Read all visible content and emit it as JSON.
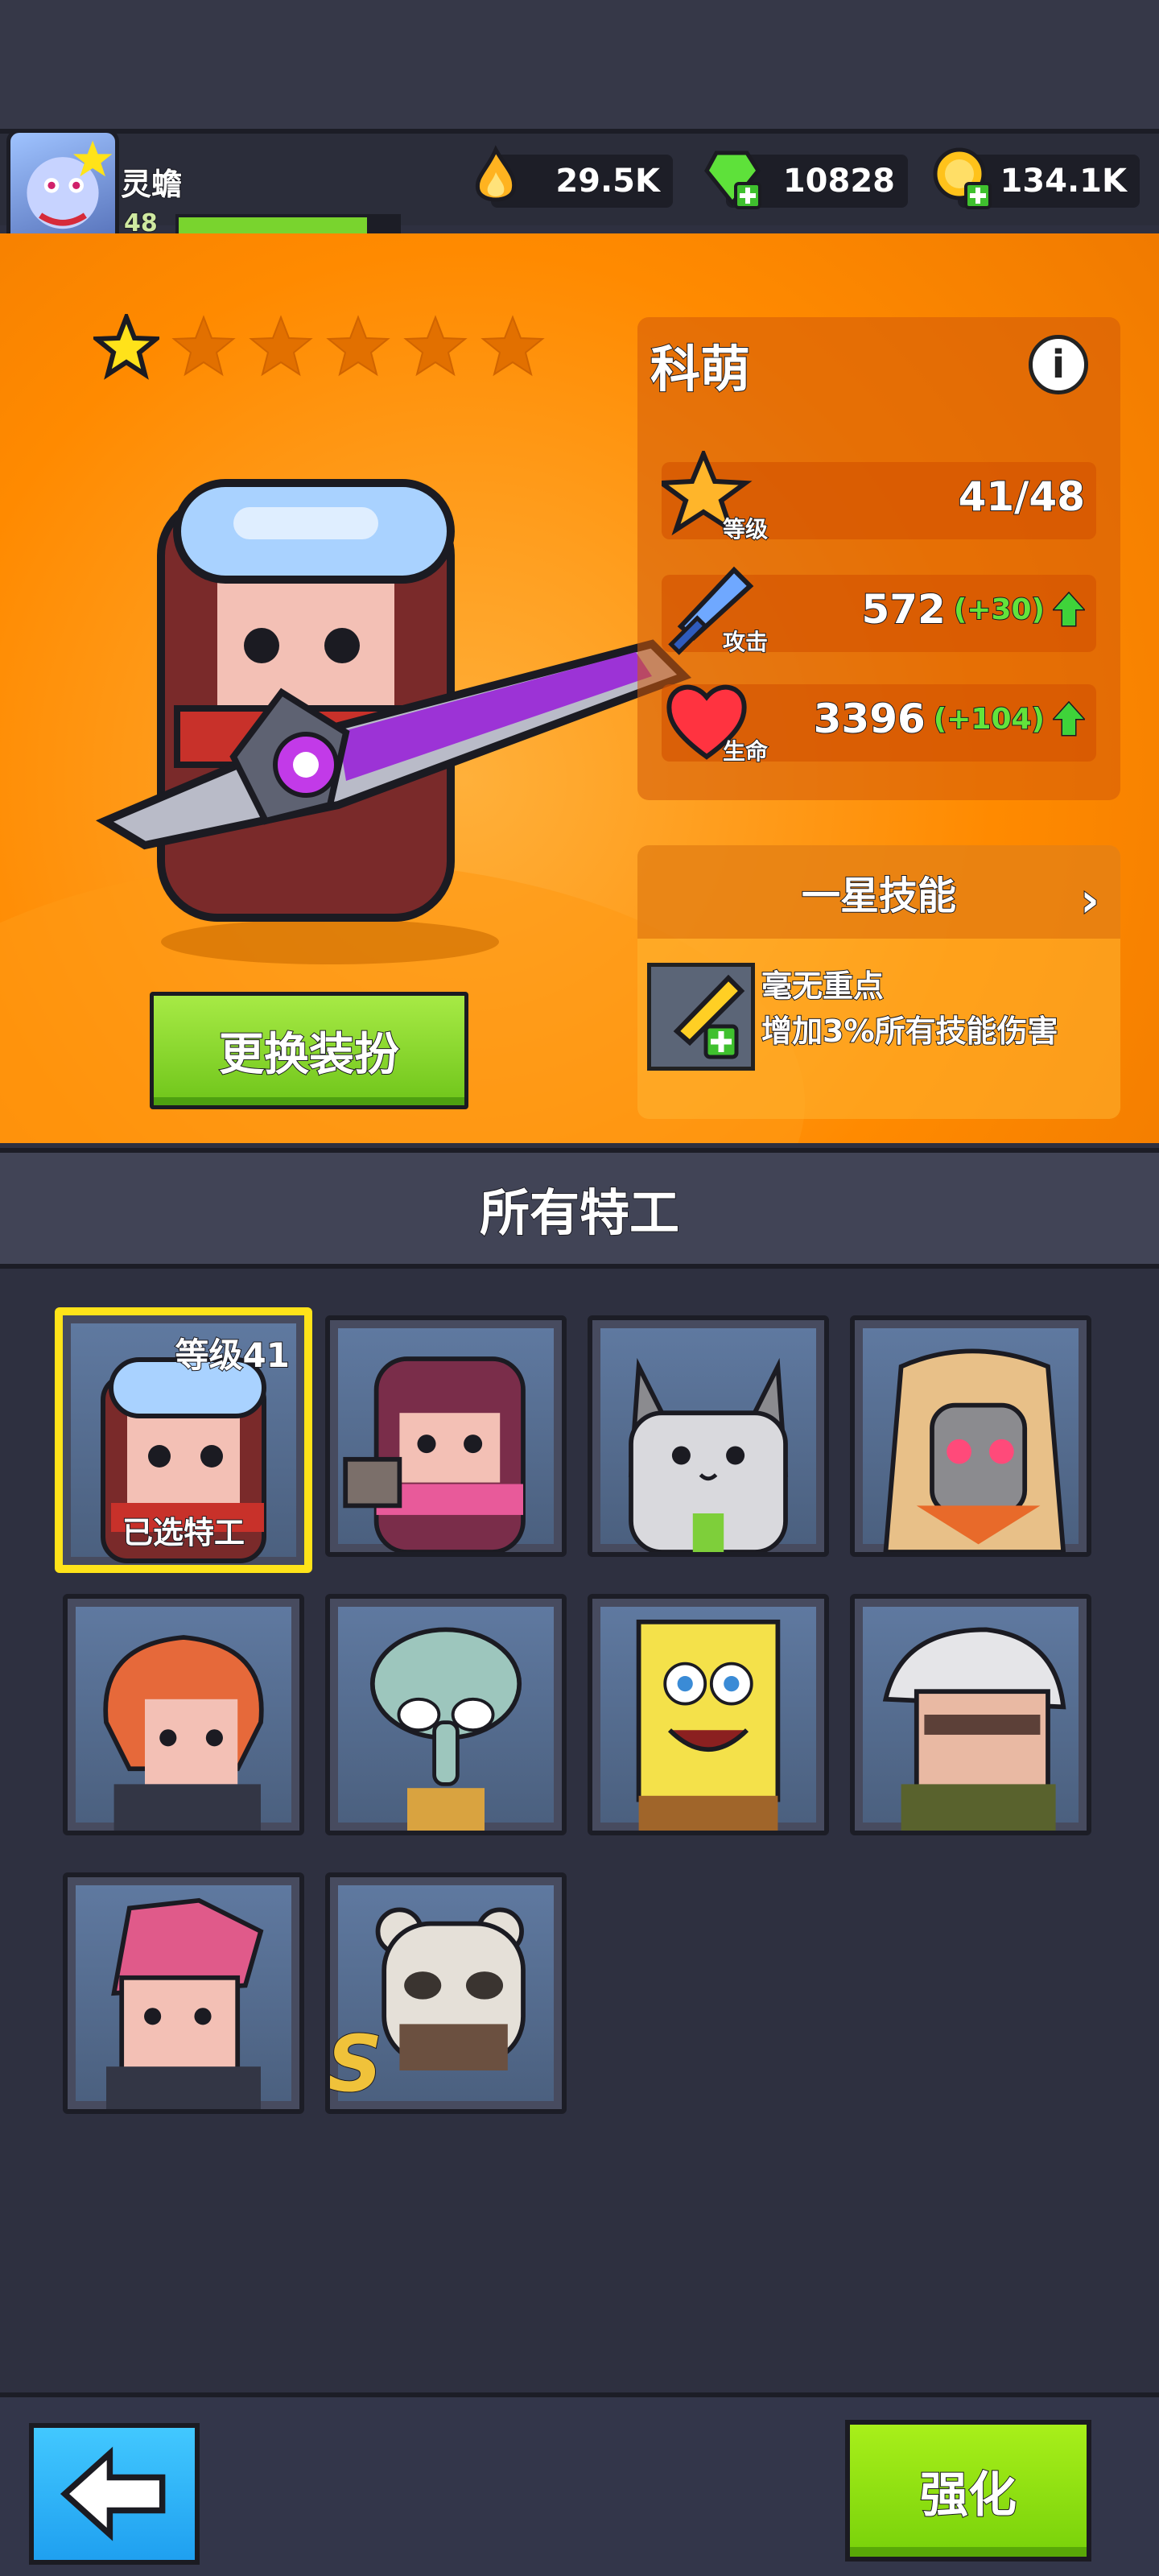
{
  "player": {
    "name": "灵蟾",
    "level": "48",
    "xp_progress": 0.86
  },
  "currencies": [
    {
      "icon": "fire-drop-icon",
      "value": "29.5K"
    },
    {
      "icon": "green-gem-plus-icon",
      "value": "10828"
    },
    {
      "icon": "gold-coin-plus-icon",
      "value": "134.1K"
    }
  ],
  "hero": {
    "stars_filled": 1,
    "stars_total": 6,
    "change_skin_label": "更换装扮",
    "name": "科萌",
    "info_icon": "i",
    "stats": [
      {
        "icon": "star-badge-icon",
        "label": "等级",
        "value": "41/48",
        "bonus": ""
      },
      {
        "icon": "sword-icon",
        "label": "攻击",
        "value": "572",
        "bonus": "(+30)"
      },
      {
        "icon": "heart-icon",
        "label": "生命",
        "value": "3396",
        "bonus": "(+104)"
      }
    ],
    "skill": {
      "header": "一星技能",
      "name": "毫无重点",
      "description": "增加3%所有技能伤害"
    }
  },
  "agents": {
    "title": "所有特工",
    "selected": {
      "level_label": "等级41",
      "selected_label": "已选特工"
    },
    "s_badge": "S"
  },
  "bottom": {
    "upgrade_label": "强化"
  },
  "colors": {
    "accent_orange": "#ff8a00",
    "green_button": "#78d10a",
    "blue_button": "#1fa0f0",
    "selected_frame": "#ffe319"
  }
}
